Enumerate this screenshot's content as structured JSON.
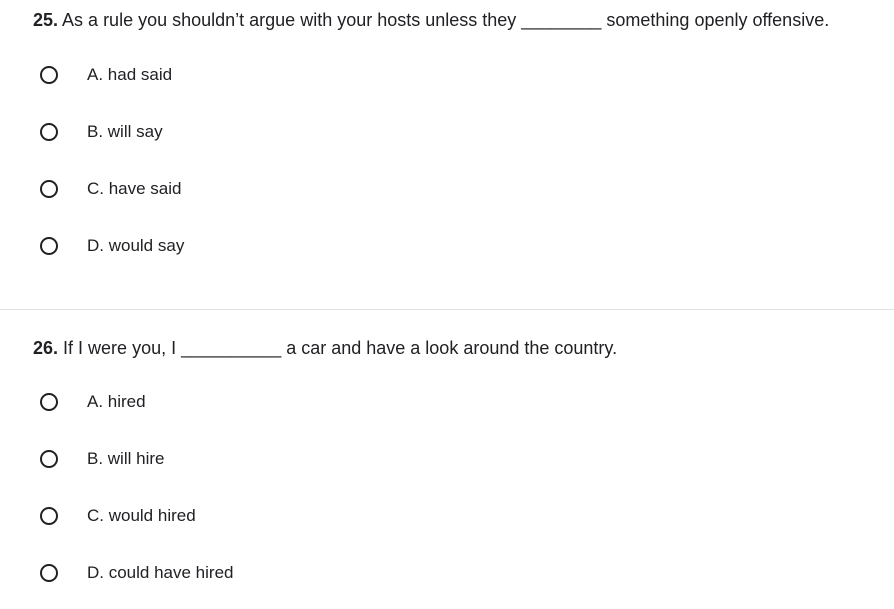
{
  "questions": [
    {
      "number": "25.",
      "text": "As a rule you shouldn’t argue with your hosts unless they ________ something openly offensive.",
      "options": [
        "A. had said",
        "B. will say",
        "C. have said",
        "D. would say"
      ]
    },
    {
      "number": "26.",
      "text": "If I were you, I __________ a car and have a look around the country.",
      "options": [
        "A. hired",
        "B. will hire",
        "C. would hired",
        "D. could have hired"
      ]
    }
  ]
}
